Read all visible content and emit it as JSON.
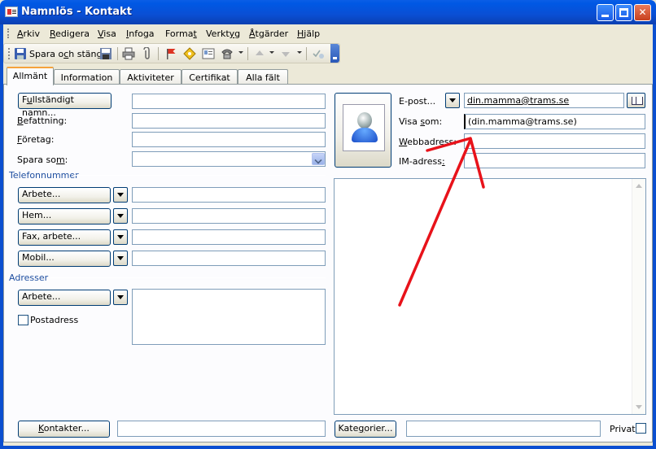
{
  "window": {
    "title": "Namnlös - Kontakt"
  },
  "menu": [
    {
      "pre": "",
      "ul": "A",
      "post": "rkiv"
    },
    {
      "pre": "",
      "ul": "R",
      "post": "edigera"
    },
    {
      "pre": "",
      "ul": "V",
      "post": "isa"
    },
    {
      "pre": "",
      "ul": "I",
      "post": "nfoga"
    },
    {
      "pre": "Forma",
      "ul": "t",
      "post": ""
    },
    {
      "pre": "Verkt",
      "ul": "y",
      "post": "g"
    },
    {
      "pre": "",
      "ul": "Å",
      "post": "tgärder"
    },
    {
      "pre": "",
      "ul": "H",
      "post": "jälp"
    }
  ],
  "toolbar": {
    "save_close_pre": "Spara o",
    "save_close_ul": "c",
    "save_close_post": "h stäng"
  },
  "tabs": [
    "Allmänt",
    "Information",
    "Aktiviteter",
    "Certifikat",
    "Alla fält"
  ],
  "general": {
    "fullname_button_pre": "F",
    "fullname_button_ul": "u",
    "fullname_button_post": "llständigt namn...",
    "title_label_pre": "",
    "title_label_ul": "B",
    "title_label_post": "efattning:",
    "company_label_pre": "",
    "company_label_ul": "F",
    "company_label_post": "öretag:",
    "file_as_label_pre": "Spara so",
    "file_as_label_ul": "m",
    "file_as_label_post": ":"
  },
  "phones": {
    "section_title": "Telefonnummer",
    "items": [
      {
        "label": "Arbete..."
      },
      {
        "label": "Hem..."
      },
      {
        "label": "Fax, arbete..."
      },
      {
        "label": "Mobil..."
      }
    ]
  },
  "addresses": {
    "section_title": "Adresser",
    "type_label": "Arbete...",
    "postal_checkbox_label": "Postadress"
  },
  "email": {
    "button_label": "E-post...",
    "value": "din.mamma@trams.se",
    "display_as_label_pre": "Visa ",
    "display_as_label_ul": "s",
    "display_as_label_post": "om:",
    "display_as_value": "(din.mamma@trams.se)",
    "web_label_pre": "",
    "web_label_ul": "W",
    "web_label_post": "ebbadress:",
    "im_label_pre": "IM-adress",
    "im_label_ul": ":",
    "im_label_post": ""
  },
  "footer": {
    "contacts_button_pre": "",
    "contacts_button_ul": "K",
    "contacts_button_post": "ontakter...",
    "categories_button_pre": "Kate",
    "categories_button_ul": "g",
    "categories_button_post": "orier...",
    "private_label": "Privat"
  },
  "colors": {
    "annotation_arrow": "#e8121a",
    "section_title": "#1f4fa0",
    "active_tab_highlight": "#f5a33c"
  }
}
